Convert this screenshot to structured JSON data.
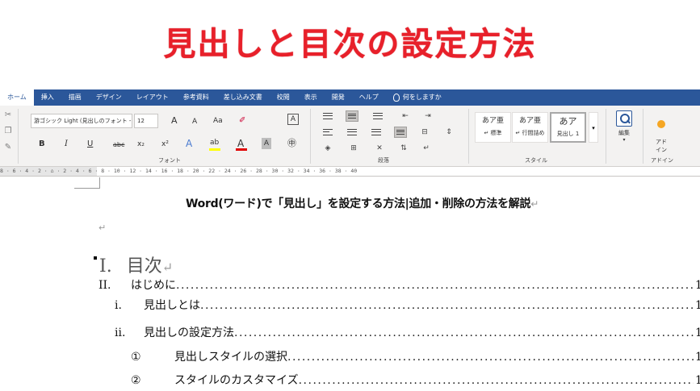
{
  "banner": {
    "title": "見出しと目次の設定方法"
  },
  "ribbon_tabs": [
    "ホーム",
    "挿入",
    "描画",
    "デザイン",
    "レイアウト",
    "参考資料",
    "差し込み文書",
    "校閲",
    "表示",
    "開発",
    "ヘルプ"
  ],
  "tell_me": "何をしますか",
  "font_group": {
    "font_name": "游ゴシック Light (見出しのフォント - 日",
    "font_size": "12",
    "grow": "A",
    "shrink": "A",
    "change_case": "Aa",
    "bold": "B",
    "italic": "I",
    "underline": "U",
    "strike": "abc",
    "subscript": "x₂",
    "superscript": "x²",
    "label": "フォント"
  },
  "paragraph_group": {
    "label": "段落"
  },
  "styles_group": {
    "label": "スタイル",
    "items": [
      {
        "sample": "あア亜",
        "name": "↵ 標準"
      },
      {
        "sample": "あア亜",
        "name": "↵ 行間詰め"
      },
      {
        "sample": "あア",
        "name": "見出し 1"
      }
    ]
  },
  "editing": {
    "label": "編集"
  },
  "addin": {
    "label": "アド\nイン",
    "group_label": "アドイン"
  },
  "ruler_text": "8 · 6 · 4 · 2 · ⌂ · 2 · 4 · 6 · 8 · 10 · 12 · 14 · 16 · 18 · 20 · 22 · 24 · 26 · 28 · 30 · 32 · 34 · 36 · 38 · 40",
  "document": {
    "heading": "Word(ワード)で「見出し」を設定する方法|追加・削除の方法を解説",
    "pilcrow": "↵",
    "toc_title_num": "I.",
    "toc_title": "目次",
    "toc": [
      {
        "num": "II.",
        "text": "はじめに",
        "page": "1"
      },
      {
        "num": "i.",
        "text": "見出しとは ",
        "page": "1"
      },
      {
        "num": "ii.",
        "text": "見出しの設定方法 ",
        "page": "1"
      },
      {
        "num": "①",
        "text": "見出しスタイルの選択",
        "page": "1"
      },
      {
        "num": "②",
        "text": "スタイルのカスタマイズ",
        "page": "1"
      }
    ]
  },
  "colors": {
    "title_red": "#e8202a",
    "ribbon_blue": "#2b579a"
  }
}
